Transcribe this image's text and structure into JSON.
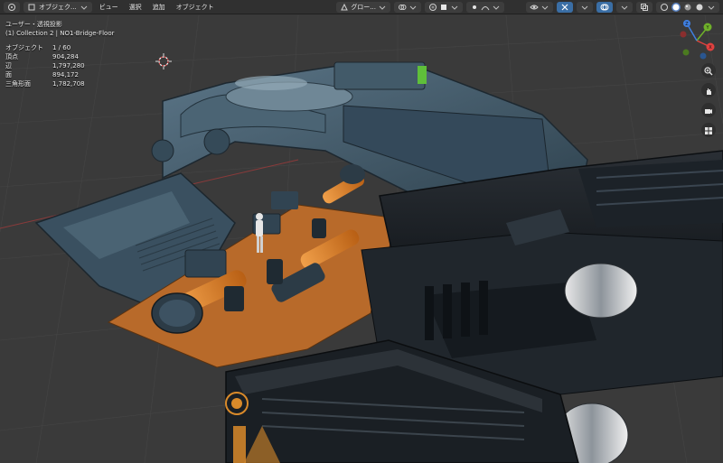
{
  "header": {
    "mode_label": "オブジェク...",
    "menus": [
      "ビュー",
      "選択",
      "追加",
      "オブジェクト"
    ],
    "transform_label": "グロー...",
    "icons": {
      "editor_type": "editor-type-icon",
      "mode": "object-mode-icon",
      "transform": "global-orientation-icon",
      "snap": "snap-icon",
      "proportional": "proportional-editing-icon",
      "visibility": "visibility-icon",
      "gizmo": "gizmo-icon",
      "overlays": "overlays-icon",
      "xray": "xray-icon",
      "shading": [
        "wireframe-shading-icon",
        "solid-shading-icon",
        "material-shading-icon",
        "rendered-shading-icon"
      ]
    }
  },
  "overlay": {
    "view_name": "ユーザー・透視投影",
    "collection": "(1) Collection 2 | NO1-Bridge-Floor",
    "stats": [
      {
        "label": "オブジェクト",
        "value": "1 / 60"
      },
      {
        "label": "頂点",
        "value": "904,284"
      },
      {
        "label": "辺",
        "value": "1,797,280"
      },
      {
        "label": "面",
        "value": "894,172"
      },
      {
        "label": "三角形面",
        "value": "1,782,708"
      }
    ]
  },
  "navigation": {
    "axes": [
      "X",
      "Y",
      "Z"
    ],
    "tools": [
      "zoom-icon",
      "pan-hand-icon",
      "camera-view-icon",
      "grid-view-icon"
    ]
  },
  "colors": {
    "accent_orange": "#e07a1f",
    "hull_blue": "#3f5a6a",
    "floor_orange": "#b86a2a",
    "header_bg": "#303030",
    "viewport_bg": "#3a3a3a",
    "axis_x": "#e0413f",
    "axis_y": "#6fb12a",
    "axis_z": "#3f7fe0"
  }
}
